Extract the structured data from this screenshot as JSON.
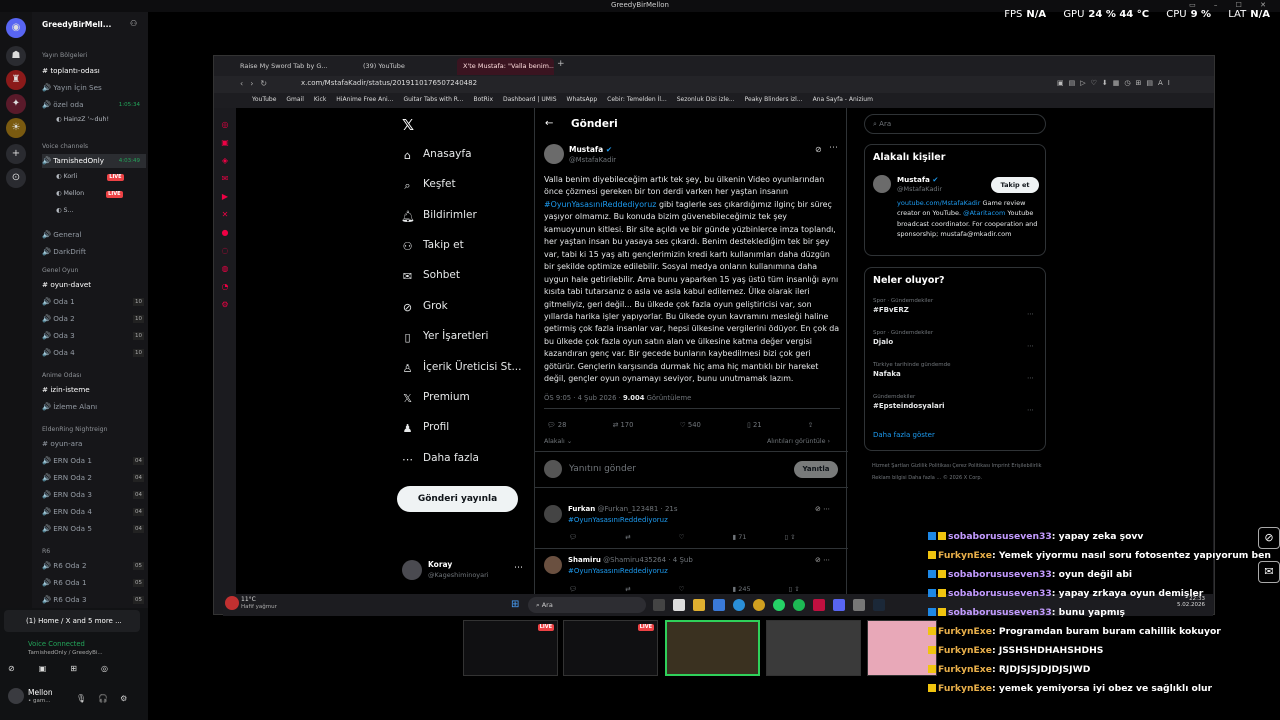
{
  "window": {
    "title": "GreedyBirMellon"
  },
  "hud": {
    "fps_label": "FPS",
    "fps": "N/A",
    "gpu_label": "GPU",
    "gpu": "24 % 44 °C",
    "cpu_label": "CPU",
    "cpu": "9 %",
    "lat_label": "LAT",
    "lat": "N/A"
  },
  "discord": {
    "server_name": "GreedyBirMell...",
    "cat1": "Yayın Bölgeleri",
    "ch_toplanti": "toplantı-odası",
    "ch_yayin": "Yayın İçin Ses",
    "ch_ozel": "özel oda",
    "ozel_time": "1:05:34",
    "ozel_user": "HainzZ '~duh!",
    "cat_voice": "Voice channels",
    "ch_tarnished": "TarnishedOnly",
    "tarnished_time": "4:03:49",
    "u_korli": "Korli",
    "u_mellon": "Mellon",
    "u_s": "S...",
    "live": "LIVE",
    "ch_general": "General",
    "ch_darkdrift": "DarkDrift",
    "cat_genel": "Genel Oyun",
    "ch_oyundavet": "oyun-davet",
    "oda1": "Oda 1",
    "oda2": "Oda 2",
    "oda3": "Oda 3",
    "oda4": "Oda 4",
    "cnt_oda": "10",
    "cat_anime": "Anime Odası",
    "ch_izin": "izin-isteme",
    "ch_izleme": "İzleme Alanı",
    "cat_elden": "EldenRing Nightreign",
    "ch_oyunara": "oyun-ara",
    "ern1": "ERN Oda 1",
    "ern2": "ERN Oda 2",
    "ern3": "ERN Oda 3",
    "ern4": "ERN Oda 4",
    "ern5": "ERN Oda 5",
    "cnt_ern": "04",
    "cat_r6": "R6",
    "r6_2": "R6 Oda 2",
    "r6_1": "R6 Oda 1",
    "r6_3": "R6 Oda 3",
    "cnt_r6": "05",
    "stream_tab": "(1) Home / X and 5 more ...",
    "voice_status": "Voice Connected",
    "voice_channel": "TarnishedOnly / GreedyBi...",
    "me": "Mellon",
    "me_status": "• gam..."
  },
  "browser": {
    "tabs": [
      "Raise My Sword Tab by G...",
      "(39) YouTube",
      "X'te Mustafa: \"Valla benim...\""
    ],
    "url": "x.com/MstafaKadir/status/2019110176507240482",
    "bookmarks": [
      "YouTube",
      "Gmail",
      "Kick",
      "HiAnime Free Ani...",
      "Guitar Tabs with R...",
      "BotRix",
      "Dashboard | UMIS",
      "WhatsApp",
      "Cebir: Temelden İl...",
      "Sezonluk Dizi izle...",
      "Peaky Blinders izl...",
      "Ana Sayfa - Anizium"
    ],
    "ai_label": "AI"
  },
  "x": {
    "nav": [
      "Anasayfa",
      "Keşfet",
      "Bildirimler",
      "Takip et",
      "Sohbet",
      "Grok",
      "Yer İşaretleri",
      "İçerik Üreticisi St...",
      "Premium",
      "Profil",
      "Daha fazla"
    ],
    "post_button": "Gönderi yayınla",
    "account_name": "Koray",
    "account_handle": "@Kageshiminoyari",
    "header": "Gönderi",
    "author": "Mustafa",
    "handle": "@MstafaKadir",
    "tweet_pre": "Valla benim diyebileceğim artık tek şey, bu ülkenin Video oyunlarından önce çözmesi gereken bir ton derdi varken her yaştan insanın ",
    "tweet_hashtag": "#OyunYasasınıReddediyoruz",
    "tweet_post": " gibi taglerle ses çıkardığımız ilginç bir süreç yaşıyor olmamız. Bu konuda bizim güvenebileceğimiz tek şey kamuoyunun kitlesi. Bir site açıldı ve bir günde yüzbinlerce imza toplandı, her yaştan insan bu yasaya ses çıkardı. Benim desteklediğim tek bir şey var, tabi ki 15 yaş altı gençlerimizin kredi kartı kullanımları daha düzgün bir şekilde optimize edilebilir. Sosyal medya onların kullanımına daha uygun hale getirilebilir. Ama bunu yaparken 15 yaş üstü tüm insanlığı aynı kısıta tabi tutarsanız o asla ve asla kabul edilemez. Ülke olarak ileri gitmeliyiz, geri değil... Bu ülkede çok fazla oyun geliştiricisi var, son yıllarda harika işler yapıyorlar. Bu ülkede oyun kavramını mesleği haline getirmiş çok fazla insanlar var, hepsi ülkesine vergilerini ödüyor. En çok da bu ülkede çok fazla oyun satın alan ve ülkesine katma değer vergisi kazandıran genç var. Bir gecede bunların kaybedilmesi bizi çok geri götürür. Gençlerin karşısında durmak hiç ama hiç mantıklı bir hareket değil, gençler oyun oynamayı seviyor, bunu unutmamak lazım.",
    "time": "ÖS 9:05 · 4 Şub 2026 · ",
    "views": "9.004",
    "views_label": " Görüntüleme",
    "replies": "28",
    "reposts": "170",
    "likes": "540",
    "bookmarks": "21",
    "related_label": "Alakalı",
    "related_show": "Alıntıları görüntüle",
    "reply_placeholder": "Yanıtını gönder",
    "reply_button": "Yanıtla",
    "r1_name": "Furkan",
    "r1_handle": "@Furkan_123481 · 21s",
    "r1_text": "#OyunYasasınıReddediyoruz",
    "r1_likes": "71",
    "r2_name": "Shamiru",
    "r2_handle": "@Shamiru435264 · 4 Şub",
    "r2_text": "#OyunYasasınıReddediyoruz",
    "r2_likes": "245",
    "search_placeholder": "Ara",
    "related_title": "Alakalı kişiler",
    "rel_name": "Mustafa",
    "rel_handle": "@MstafaKadir",
    "follow": "Takip et",
    "rel_bio_link": "youtube.com/MstafaKadir",
    "rel_bio1": " Game review creator on YouTube. ",
    "rel_bio_link2": "@Ataritacom",
    "rel_bio2": " Youtube broadcast coordinator. For cooperation and sponsorship; mustafa@mkadir.com",
    "trends_title": "Neler oluyor?",
    "trends": [
      {
        "ctx": "Spor · Gündemdekiler",
        "name": "#FBvERZ"
      },
      {
        "ctx": "Spor · Gündemdekiler",
        "name": "Djalo"
      },
      {
        "ctx": "Türkiye tarihinde gündemde",
        "name": "Nafaka"
      },
      {
        "ctx": "Gündemdekiler",
        "name": "#Epsteindosyalari"
      }
    ],
    "show_more": "Daha fazla göster",
    "footer": "Hizmet Şartları   Gizlilik Politikası   Çerez Politikası   Imprint   Erişilebilirlik   Reklam bilgisi   Daha fazla ...   © 2026 X Corp."
  },
  "taskbar": {
    "weather_temp": "11°C",
    "weather_desc": "Hafif yağmur",
    "search": "Ara",
    "time": "22:33",
    "date": "5.02.2026"
  },
  "chat": [
    {
      "user": "sobaborususeven33",
      "msg": ": yapay zeka şovv",
      "style": "u1"
    },
    {
      "user": "FurkynExe",
      "msg": ": Yemek yiyormu nasıl soru fotosentez yapıyorum ben",
      "style": "u2"
    },
    {
      "user": "sobaborususeven33",
      "msg": ": oyun değil abi",
      "style": "u1"
    },
    {
      "user": "sobaborususeven33",
      "msg": ": yapay zrkaya oyun demişler",
      "style": "u1"
    },
    {
      "user": "sobaborususeven33",
      "msg": ": bunu yapmış",
      "style": "u1"
    },
    {
      "user": "FurkynExe",
      "msg": ": Programdan buram buram cahillik kokuyor",
      "style": "u2"
    },
    {
      "user": "FurkynExe",
      "msg": ": JSSHSHDHAHSHDHS",
      "style": "u2"
    },
    {
      "user": "FurkynExe",
      "msg": ": RJDJSJSJDJDJSJWD",
      "style": "u2"
    },
    {
      "user": "FurkynExe",
      "msg": ": yemek yemiyorsa iyi obez ve sağlıklı olur",
      "style": "u2"
    }
  ],
  "colors": {
    "accent": "#1d9bf0",
    "live": "#ed4245",
    "chat_user1": "#c39bff",
    "chat_user2": "#e9b04a"
  }
}
